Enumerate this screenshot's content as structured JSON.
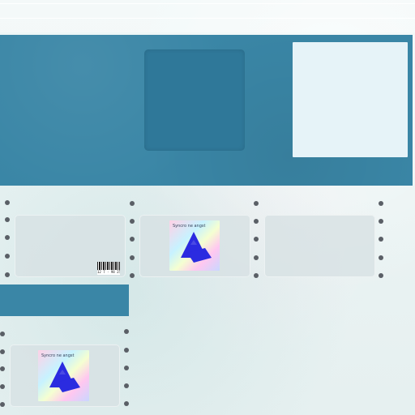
{
  "header": {
    "strip_lines": 2
  },
  "hero": {
    "thumbnail_icon": "image-placeholder-icon",
    "card_icon": "blank-card-icon",
    "colors": {
      "panel": "#3a86a6",
      "thumbnail": "#2f7899",
      "card": "#e6f3f8"
    }
  },
  "gallery": {
    "row1": [
      {
        "type": "frame",
        "icon": "barcode-icon"
      },
      {
        "type": "frame",
        "icon": "album-art-icon"
      },
      {
        "type": "frame",
        "icon": "empty-frame-icon"
      }
    ],
    "row2": [
      {
        "type": "frame",
        "icon": "album-art-icon"
      }
    ]
  },
  "album_art": {
    "tag_text": "Syncro ne angst"
  },
  "barcode": {
    "number": "12 7 · 98 251"
  },
  "colors": {
    "accent_blue": "#3a86a6",
    "album_logo": "#2b2be0",
    "dot": "#5a5f66",
    "background": "#e9f2f2"
  }
}
